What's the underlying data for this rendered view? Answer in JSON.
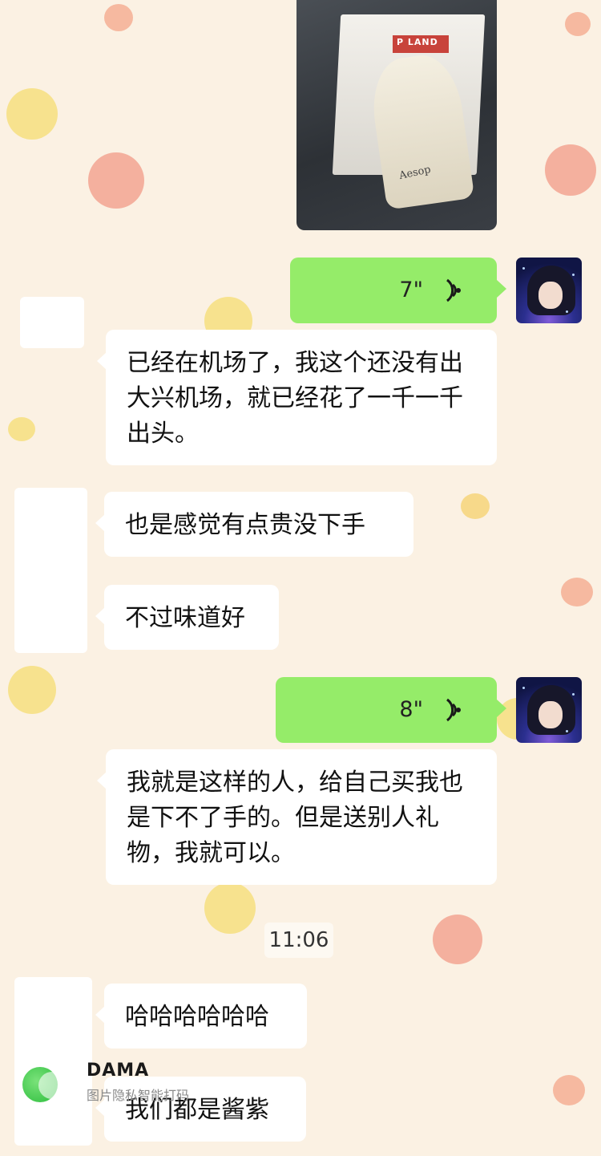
{
  "photo_message": {
    "icon": "image-photo",
    "bag_label": "P LAND",
    "brand_text": "Aesop"
  },
  "messages": [
    {
      "id": "voice-1",
      "side": "right",
      "type": "voice",
      "duration": "7\"",
      "icon": "voice-wave-icon"
    },
    {
      "id": "text-1",
      "side": "left",
      "type": "text",
      "text": "已经在机场了，我这个还没有出大兴机场，就已经花了一千一千出头。"
    },
    {
      "id": "text-2",
      "side": "left",
      "type": "text",
      "text": "也是感觉有点贵没下手"
    },
    {
      "id": "text-3",
      "side": "left",
      "type": "text",
      "text": "不过味道好"
    },
    {
      "id": "voice-2",
      "side": "right",
      "type": "voice",
      "duration": "8\"",
      "icon": "voice-wave-icon"
    },
    {
      "id": "text-4",
      "side": "left",
      "type": "text",
      "text": "我就是这样的人，给自己买我也是下不了手的。但是送别人礼物，我就可以。"
    },
    {
      "id": "text-5",
      "side": "left",
      "type": "text",
      "text": "哈哈哈哈哈哈"
    },
    {
      "id": "text-6",
      "side": "left",
      "type": "text",
      "text": "我们都是酱紫"
    }
  ],
  "timestamp": "11:06",
  "watermark": {
    "title": "DAMA",
    "subtitle": "图片隐私智能打码"
  },
  "colors": {
    "background": "#fbf1e3",
    "bubble_right": "#95ec69",
    "bubble_left": "#ffffff"
  }
}
